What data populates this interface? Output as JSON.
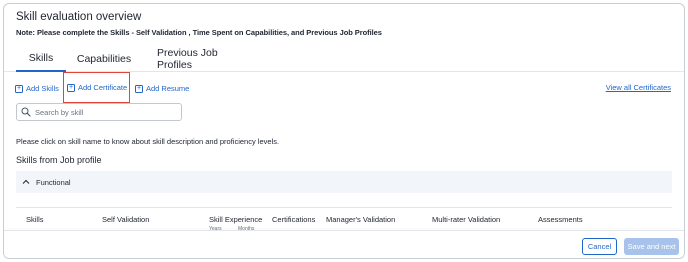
{
  "page": {
    "title": "Skill evaluation overview",
    "note": "Note: Please complete the Skills - Self Validation , Time Spent on Capabilities, and Previous Job Profiles"
  },
  "tabs": [
    {
      "label": "Skills",
      "active": true
    },
    {
      "label": "Capabilities",
      "active": false
    },
    {
      "label": "Previous Job Profiles",
      "active": false
    }
  ],
  "actions": {
    "add_skills": "Add Skills",
    "add_certificate": "Add Certificate",
    "add_resume": "Add Resume",
    "view_all_certificates": "View all Certificates"
  },
  "search": {
    "placeholder": "Search by skill",
    "value": ""
  },
  "hint": "Please click on skill name to know about skill description and proficiency levels.",
  "section": {
    "title": "Skills from Job profile",
    "accordion_label": "Functional"
  },
  "table": {
    "headers": [
      "Skills",
      "Self Validation",
      "Skill Experience",
      "Certifications",
      "Manager's Validation",
      "Multi-rater Validation",
      "Assessments"
    ],
    "sub_headers": [
      "Years",
      "Months"
    ]
  },
  "footer": {
    "cancel_label": "Cancel",
    "next_label": "Save and next"
  },
  "colors": {
    "accent": "#2167c9",
    "highlight_box": "#e0453a",
    "disabled_button": "#a7c3ec",
    "accordion_bg": "#f2f6fb"
  }
}
